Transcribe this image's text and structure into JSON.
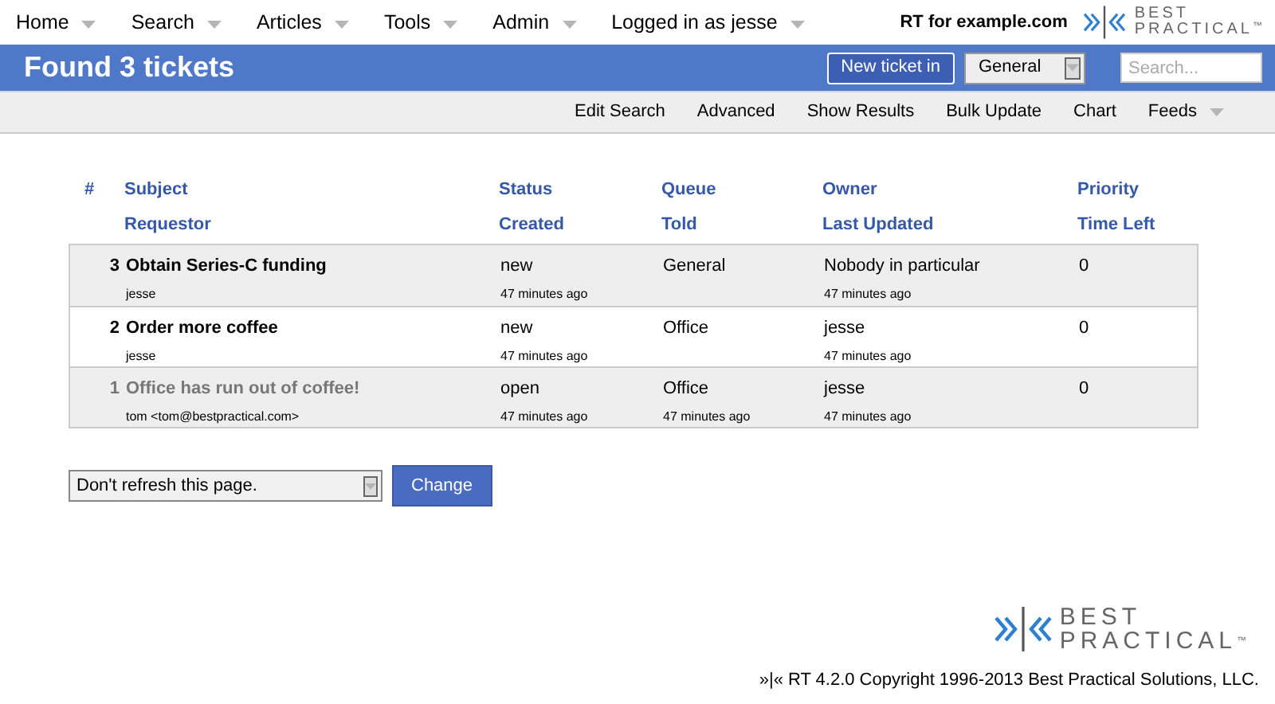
{
  "top_menu": [
    {
      "label": "Home"
    },
    {
      "label": "Search"
    },
    {
      "label": "Articles"
    },
    {
      "label": "Tools"
    },
    {
      "label": "Admin"
    },
    {
      "label": "Logged in as jesse"
    }
  ],
  "site_name": "RT for example.com",
  "logo": {
    "line_1": "BEST",
    "line_2": "PRACTICAL",
    "mark": "™"
  },
  "page_title": "Found 3 tickets",
  "new_ticket_button": "New ticket in",
  "queue_select": "General",
  "search": {
    "placeholder": "Search..."
  },
  "sub_menu": [
    {
      "label": "Edit Search",
      "dropdown": false
    },
    {
      "label": "Advanced",
      "dropdown": false
    },
    {
      "label": "Show Results",
      "dropdown": false
    },
    {
      "label": "Bulk Update",
      "dropdown": false
    },
    {
      "label": "Chart",
      "dropdown": false
    },
    {
      "label": "Feeds",
      "dropdown": true
    }
  ],
  "table": {
    "columns": [
      [
        "#",
        ""
      ],
      [
        "Subject",
        "Requestor"
      ],
      [
        "Status",
        "Created"
      ],
      [
        "Queue",
        "Told"
      ],
      [
        "Owner",
        "Last Updated"
      ],
      [
        "Priority",
        "Time Left"
      ]
    ],
    "rows": [
      {
        "id": "3",
        "subject": "Obtain Series-C funding",
        "requestor": "jesse",
        "status": "new",
        "created": "47 minutes ago",
        "queue": "General",
        "told": "",
        "owner": "Nobody in particular",
        "last_updated": "47 minutes ago",
        "priority": "0",
        "dimmed": false
      },
      {
        "id": "2",
        "subject": "Order more coffee",
        "requestor": "jesse",
        "status": "new",
        "created": "47 minutes ago",
        "queue": "Office",
        "told": "",
        "owner": "jesse",
        "last_updated": "47 minutes ago",
        "priority": "0",
        "dimmed": false
      },
      {
        "id": "1",
        "subject": "Office has run out of coffee!",
        "requestor": "tom <tom@bestpractical.com>",
        "status": "open",
        "created": "47 minutes ago",
        "queue": "Office",
        "told": "47 minutes ago",
        "owner": "jesse",
        "last_updated": "47 minutes ago",
        "priority": "0",
        "dimmed": true
      }
    ]
  },
  "refresh_select": "Don't refresh this page.",
  "change_button": "Change",
  "footer": {
    "logo": {
      "line_1": "BEST",
      "line_2": "PRACTICAL",
      "mark": "™"
    },
    "mark": "»|«",
    "copyright": "RT 4.2.0 Copyright 1996-2013 Best Practical Solutions, LLC."
  }
}
